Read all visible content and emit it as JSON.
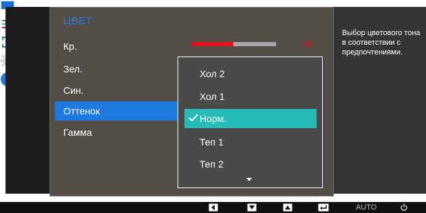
{
  "colors": {
    "accent_blue": "#1f7ae0",
    "selected_teal": "#27bcb5",
    "slider_red": "#e8101a",
    "panel_bg": "#534d47"
  },
  "sidebar": {
    "icons": [
      {
        "name": "monitor-icon",
        "selected": false
      },
      {
        "name": "picture-settings-icon",
        "selected": true
      },
      {
        "name": "resize-icon",
        "selected": false
      },
      {
        "name": "gear-icon",
        "selected": false
      },
      {
        "name": "info-icon",
        "selected": false
      }
    ]
  },
  "menu": {
    "title": "ЦВЕТ",
    "items": [
      {
        "label": "Кр."
      },
      {
        "label": "Зел."
      },
      {
        "label": "Син."
      },
      {
        "label": "Оттенок",
        "selected": true
      },
      {
        "label": "Гамма"
      }
    ],
    "red_slider": {
      "value": 50,
      "max": 100,
      "value_label": "50"
    }
  },
  "dropdown": {
    "options": [
      {
        "label": "Хол 2"
      },
      {
        "label": "Хол 1"
      },
      {
        "label": "Норм.",
        "selected": true
      },
      {
        "label": "Теп 1"
      },
      {
        "label": "Теп 2"
      }
    ],
    "more_icon": "chevron-down-icon"
  },
  "help": {
    "text": "Выбор цветового тона в соответствии с предпочтениями."
  },
  "bottom_bar": {
    "buttons": [
      {
        "name": "left-arrow-icon"
      },
      {
        "name": "down-arrow-icon"
      },
      {
        "name": "up-arrow-icon"
      },
      {
        "name": "enter-icon"
      },
      {
        "name": "auto-button",
        "label": "AUTO"
      },
      {
        "name": "power-icon"
      }
    ]
  }
}
